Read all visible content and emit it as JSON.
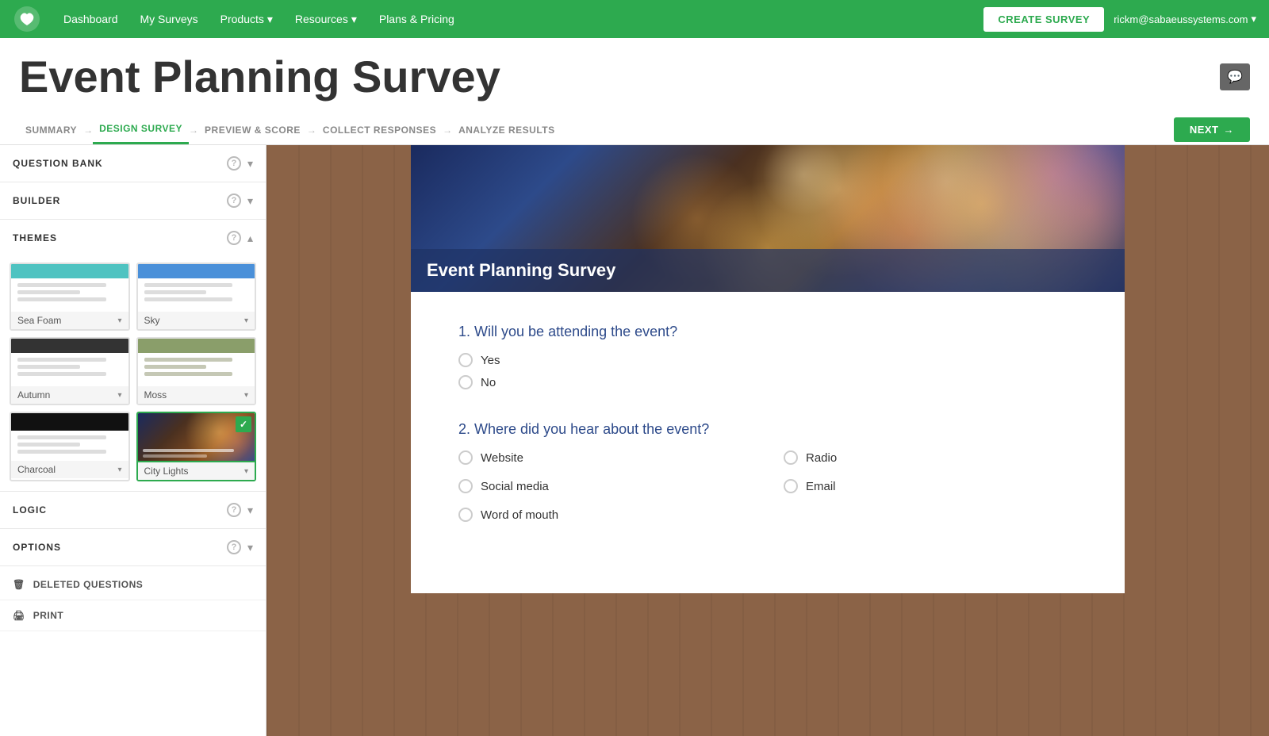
{
  "nav": {
    "logo_alt": "SurveyGizmo",
    "links": [
      {
        "label": "Dashboard",
        "has_dropdown": false
      },
      {
        "label": "My Surveys",
        "has_dropdown": false
      },
      {
        "label": "Products",
        "has_dropdown": true
      },
      {
        "label": "Resources",
        "has_dropdown": true
      },
      {
        "label": "Plans & Pricing",
        "has_dropdown": false
      }
    ],
    "create_survey_label": "CREATE SURVEY",
    "user_email": "rickm@sabaeussystems.com"
  },
  "page": {
    "survey_title": "Event Planning Survey",
    "comment_icon": "💬"
  },
  "breadcrumbs": [
    {
      "label": "SUMMARY",
      "active": false
    },
    {
      "label": "DESIGN SURVEY",
      "active": true
    },
    {
      "label": "PREVIEW & SCORE",
      "active": false
    },
    {
      "label": "COLLECT RESPONSES",
      "active": false
    },
    {
      "label": "ANALYZE RESULTS",
      "active": false
    }
  ],
  "next_button": "NEXT",
  "sidebar": {
    "sections": [
      {
        "id": "question-bank",
        "title": "QUESTION BANK",
        "expanded": false
      },
      {
        "id": "builder",
        "title": "BUILDER",
        "expanded": false
      },
      {
        "id": "themes",
        "title": "THEMES",
        "expanded": true
      }
    ],
    "themes": [
      {
        "id": "seafoam",
        "label": "Sea Foam",
        "header_class": "seafoam-header",
        "selected": false
      },
      {
        "id": "sky",
        "label": "Sky",
        "header_class": "sky-header",
        "selected": false
      },
      {
        "id": "autumn",
        "label": "Autumn",
        "header_class": "autumn-header",
        "selected": false
      },
      {
        "id": "moss",
        "label": "Moss",
        "header_class": "moss-header",
        "selected": false
      },
      {
        "id": "charcoal",
        "label": "Charcoal",
        "header_class": "charcoal-header",
        "selected": false
      },
      {
        "id": "city-lights",
        "label": "City Lights",
        "header_class": "city-lights-header",
        "selected": true
      }
    ],
    "sections2": [
      {
        "id": "logic",
        "title": "LOGIC",
        "expanded": false
      },
      {
        "id": "options",
        "title": "OPTIONS",
        "expanded": false
      }
    ],
    "bottom_items": [
      {
        "id": "deleted-questions",
        "label": "DELETED QUESTIONS",
        "icon": "🗑"
      },
      {
        "id": "print",
        "label": "PRINT",
        "icon": "🖨"
      }
    ]
  },
  "survey": {
    "header_title": "Event Planning Survey",
    "questions": [
      {
        "number": "1",
        "text": "Will you be attending the event?",
        "type": "radio",
        "options": [
          {
            "label": "Yes"
          },
          {
            "label": "No"
          }
        ]
      },
      {
        "number": "2",
        "text": "Where did you hear about the event?",
        "type": "radio-grid",
        "options": [
          {
            "label": "Website"
          },
          {
            "label": "Radio"
          },
          {
            "label": "Social media"
          },
          {
            "label": "Email"
          },
          {
            "label": "Word of mouth"
          },
          {
            "label": ""
          }
        ]
      }
    ]
  }
}
